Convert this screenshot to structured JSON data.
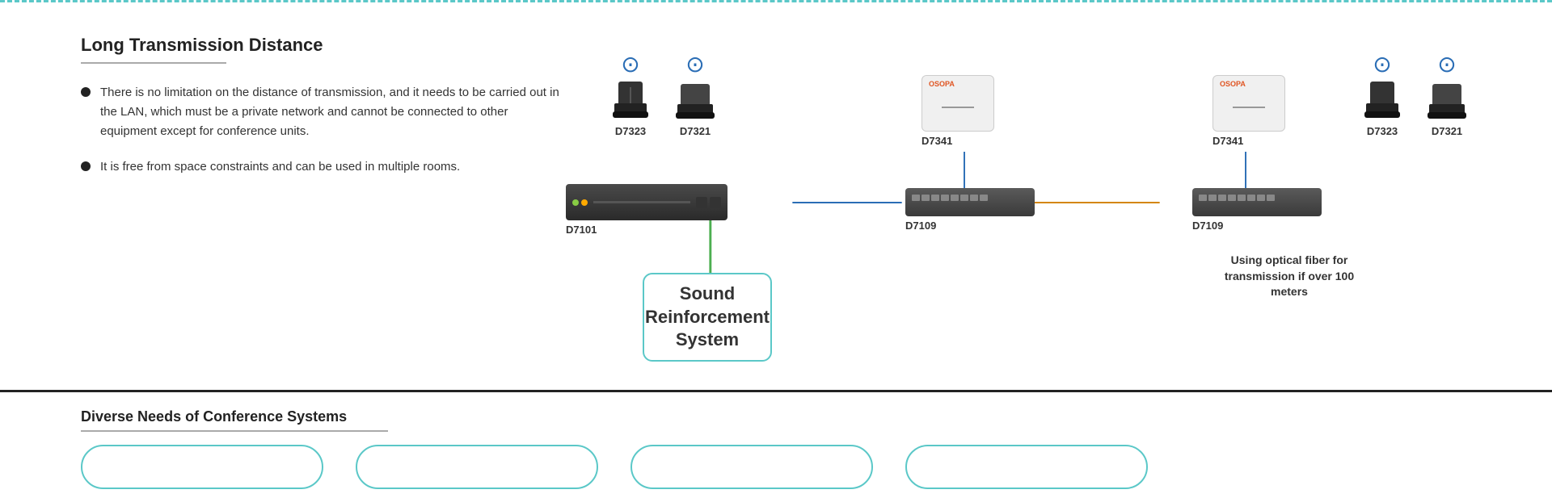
{
  "top_border": true,
  "left_panel": {
    "title": "Long Transmission Distance",
    "bullets": [
      "There is no limitation on the distance of transmission, and it needs to be carried out in the LAN, which must be a private network and cannot be connected to other equipment except for conference units.",
      "It is free from space constraints and can be used in multiple rooms."
    ]
  },
  "diagram": {
    "devices": {
      "left_group": {
        "mic1_label": "D7323",
        "mic2_label": "D7321",
        "controller_label": "D7101",
        "switch1_label": "D7109",
        "ap1_label": "D7341",
        "ap1_brand": "OSOPA"
      },
      "right_group": {
        "ap2_label": "D7341",
        "ap2_brand": "OSOPA",
        "switch2_label": "D7109",
        "mic3_label": "D7323",
        "mic4_label": "D7321"
      },
      "sr_box": {
        "line1": "Sound",
        "line2": "Reinforcement",
        "line3": "System"
      },
      "fiber_note": "Using optical fiber for transmission if over 100 meters"
    }
  },
  "bottom_section": {
    "title": "Diverse Needs of Conference Systems",
    "cards": [
      "",
      "",
      "",
      ""
    ]
  },
  "colors": {
    "teal": "#5bc8c8",
    "blue": "#2a6db5",
    "dark": "#222222",
    "orange": "#d4860a",
    "green": "#4caf50"
  }
}
